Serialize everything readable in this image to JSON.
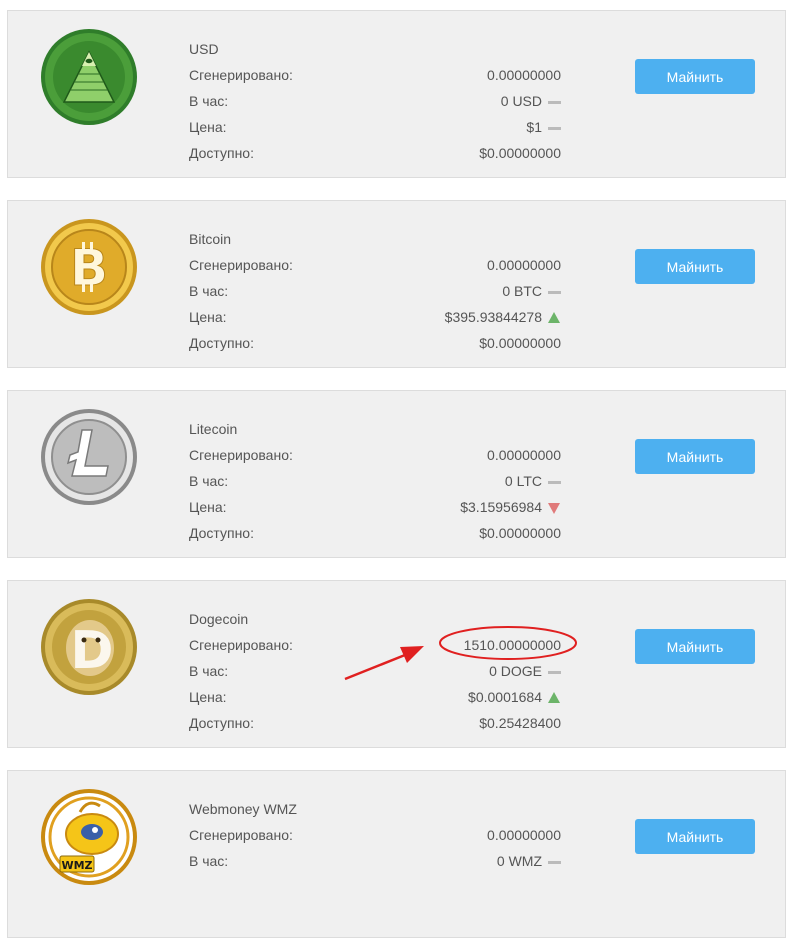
{
  "labels": {
    "generated": "Сгенерировано:",
    "per_hour": "В час:",
    "price": "Цена:",
    "available": "Доступно:",
    "mine_button": "Майнить"
  },
  "coins": [
    {
      "name": "USD",
      "icon": "dollar-pyramid-icon",
      "generated": "0.00000000",
      "per_hour": "0 USD",
      "per_hour_trend": "flat",
      "price": "$1",
      "price_trend": "flat",
      "available": "$0.00000000",
      "button": "Майнить"
    },
    {
      "name": "Bitcoin",
      "icon": "bitcoin-icon",
      "generated": "0.00000000",
      "per_hour": "0 BTC",
      "per_hour_trend": "flat",
      "price": "$395.93844278",
      "price_trend": "up",
      "available": "$0.00000000",
      "button": "Майнить"
    },
    {
      "name": "Litecoin",
      "icon": "litecoin-icon",
      "generated": "0.00000000",
      "per_hour": "0 LTC",
      "per_hour_trend": "flat",
      "price": "$3.15956984",
      "price_trend": "down",
      "available": "$0.00000000",
      "button": "Майнить"
    },
    {
      "name": "Dogecoin",
      "icon": "dogecoin-icon",
      "generated": "1510.00000000",
      "per_hour": "0 DOGE",
      "per_hour_trend": "flat",
      "price": "$0.0001684",
      "price_trend": "up",
      "available": "$0.25428400",
      "button": "Майнить"
    },
    {
      "name": "Webmoney WMZ",
      "icon": "webmoney-wmz-icon",
      "icon_text": "WMZ",
      "generated": "0.00000000",
      "per_hour": "0 WMZ",
      "per_hour_trend": "flat",
      "button": "Майнить"
    }
  ],
  "colors": {
    "card_bg": "#f0f0f0",
    "button": "#4db0f0",
    "trend_up": "#6cb469",
    "trend_down": "#e07a7a",
    "trend_flat": "#bbbbbb",
    "annotation": "#e02020"
  },
  "annotation": {
    "type": "red-ellipse-and-arrow",
    "target": "Dogecoin generated value"
  }
}
